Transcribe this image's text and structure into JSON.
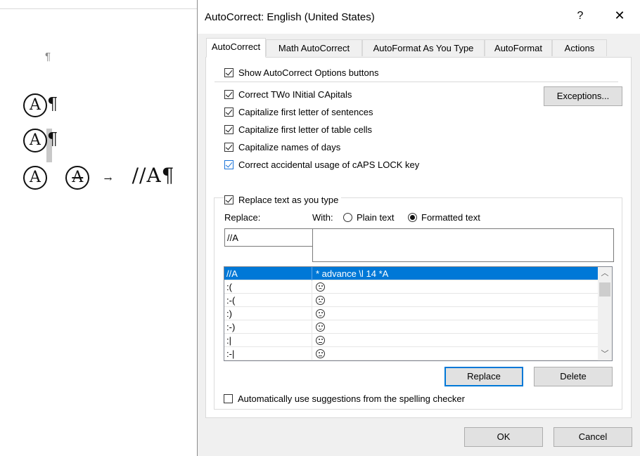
{
  "document": {
    "pilcrow": "¶",
    "circled_a": "A",
    "arrow": "→",
    "text_line3": "//A¶"
  },
  "dialog": {
    "title": "AutoCorrect: English (United States)",
    "help": "?",
    "close": "✕",
    "tabs": [
      "AutoCorrect",
      "Math AutoCorrect",
      "AutoFormat As You Type",
      "AutoFormat",
      "Actions"
    ],
    "options": {
      "show_buttons": "Show AutoCorrect Options buttons",
      "two_initials": "Correct TWo INitial CApitals",
      "first_sentence": "Capitalize first letter of sentences",
      "first_table": "Capitalize first letter of table cells",
      "names_days": "Capitalize names of days",
      "caps_lock": "Correct accidental usage of cAPS LOCK key",
      "replace_as_type": "Replace text as you type",
      "use_suggestions": "Automatically use suggestions from the spelling checker"
    },
    "exceptions_btn": "Exceptions...",
    "replace_label": "Replace:",
    "with_label": "With:",
    "plain_text": "Plain text",
    "formatted_text": "Formatted text",
    "replace_value": "//A",
    "with_value": "",
    "list_rows": [
      {
        "replace": "//A",
        "with": "* advance \\l 14 *A",
        "selected": true
      },
      {
        "replace": ":(",
        "face": "sad"
      },
      {
        "replace": ":-(",
        "face": "sad"
      },
      {
        "replace": ":)",
        "face": "happy"
      },
      {
        "replace": ":-)",
        "face": "happy"
      },
      {
        "replace": ":|",
        "face": "neutral"
      },
      {
        "replace": ":-|",
        "face": "neutral"
      }
    ],
    "replace_btn": "Replace",
    "delete_btn": "Delete",
    "ok_btn": "OK",
    "cancel_btn": "Cancel",
    "accent_color": "#0078d7"
  }
}
